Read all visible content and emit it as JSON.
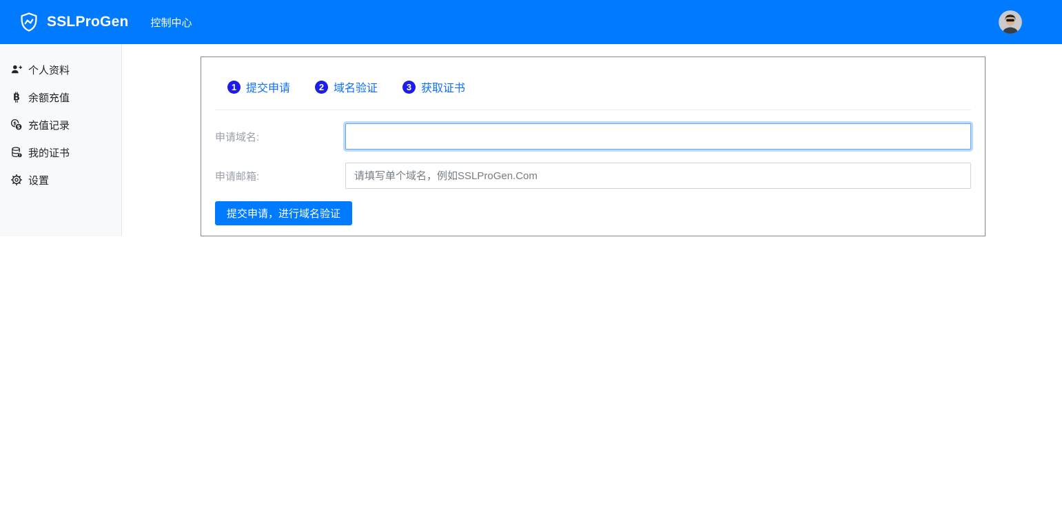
{
  "header": {
    "brand": "SSLProGen",
    "nav_control_center": "控制中心"
  },
  "sidebar": {
    "items": [
      {
        "icon": "user-plus-icon",
        "label": "个人资料"
      },
      {
        "icon": "bitcoin-icon",
        "label": "余额充值"
      },
      {
        "icon": "coins-icon",
        "label": "充值记录"
      },
      {
        "icon": "certificate-icon",
        "label": "我的证书"
      },
      {
        "icon": "gear-icon",
        "label": "设置"
      }
    ]
  },
  "wizard": {
    "steps": [
      {
        "number": "1",
        "label": "提交申请"
      },
      {
        "number": "2",
        "label": "域名验证"
      },
      {
        "number": "3",
        "label": "获取证书"
      }
    ]
  },
  "form": {
    "domain_label": "申请域名:",
    "domain_value": "",
    "domain_placeholder": "",
    "email_label": "申请邮箱:",
    "email_value": "",
    "email_placeholder": "请填写单个域名，例如SSLProGen.Com",
    "submit_label": "提交申请，进行域名验证"
  },
  "colors": {
    "primary": "#007bff",
    "step_badge": "#1e1ce8",
    "step_text": "#0d6efd",
    "sidebar_bg": "#f8f9fa"
  }
}
